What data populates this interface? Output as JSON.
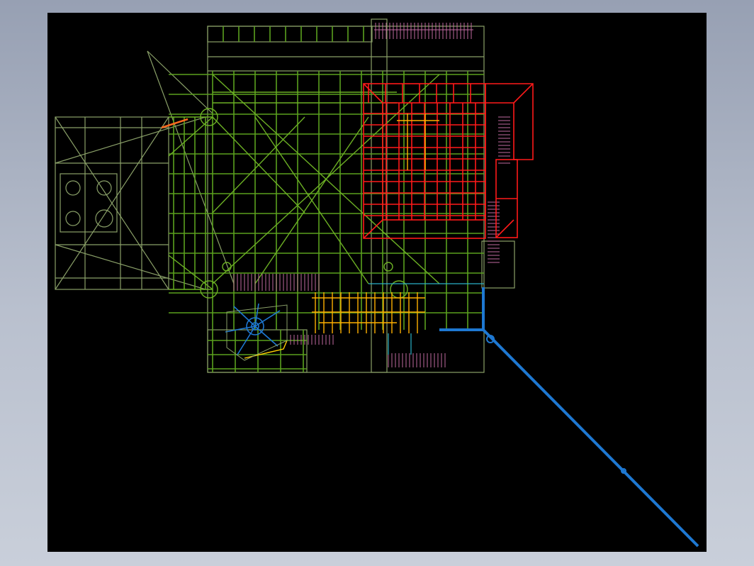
{
  "viewer": {
    "background": "#000000",
    "frame_gradient": [
      "#97a0b3",
      "#c9cfda"
    ]
  },
  "drawing": {
    "type": "cad-wireframe-plan",
    "layers": [
      {
        "name": "structure",
        "color": "#5aa01e"
      },
      {
        "name": "outline",
        "color": "#8aa068"
      },
      {
        "name": "equipment",
        "color": "#ff1a1a"
      },
      {
        "name": "stairs",
        "color": "#c06aa0"
      },
      {
        "name": "pipes",
        "color": "#1e78d2"
      },
      {
        "name": "details",
        "color": "#ffb000"
      },
      {
        "name": "cyan",
        "color": "#2ab0c8"
      }
    ]
  }
}
